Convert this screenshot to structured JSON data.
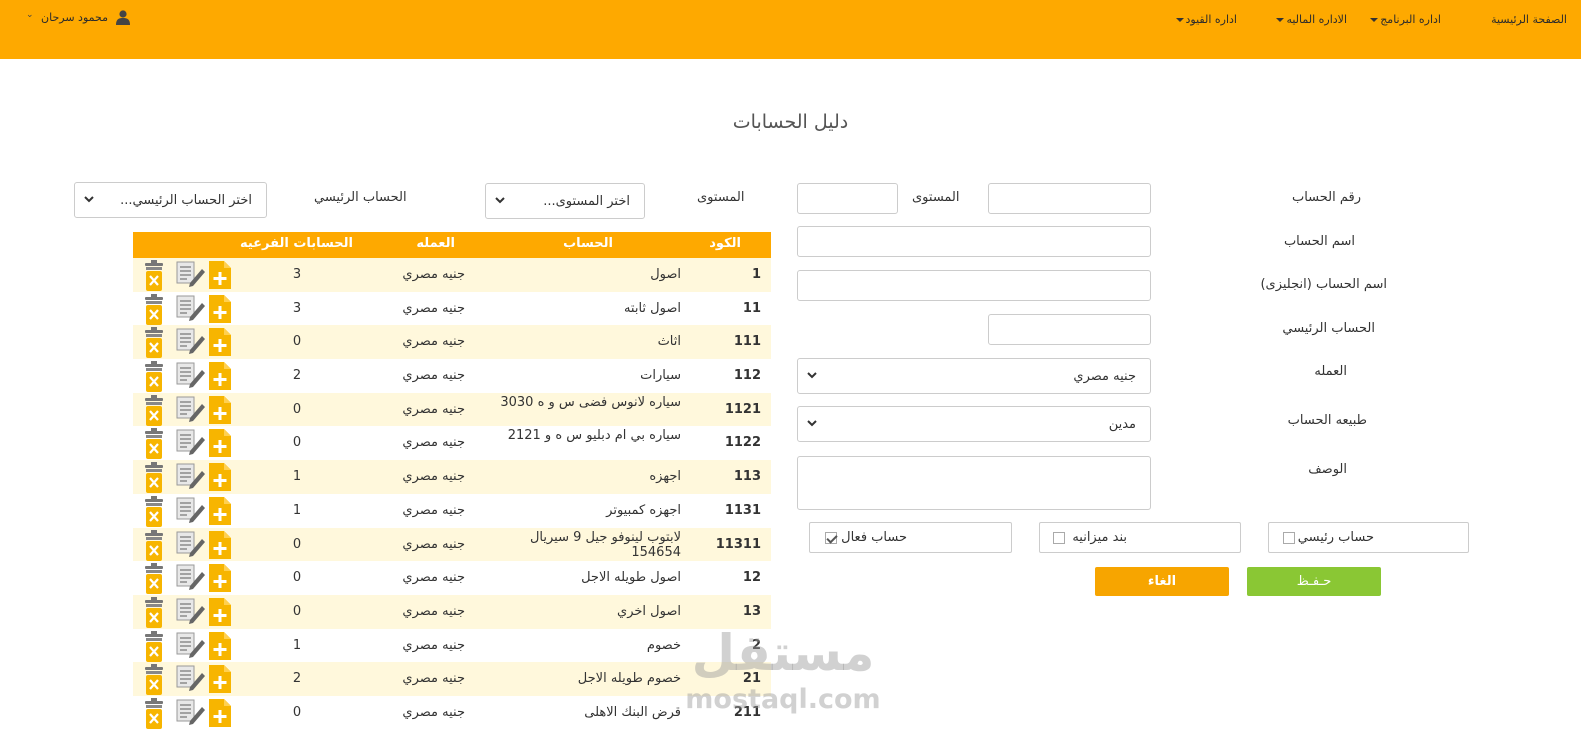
{
  "nav": {
    "items": [
      {
        "label": "الصفحة الرئيسية",
        "dropdown": false
      },
      {
        "label": "اداره البرنامج",
        "dropdown": true
      },
      {
        "label": "الاداره الماليه",
        "dropdown": true
      },
      {
        "label": "اداره القيود",
        "dropdown": true
      }
    ],
    "user": {
      "name": "محمود سرحان",
      "icon": "user-icon"
    }
  },
  "page_title": "دليل الحسابات",
  "form": {
    "account_number_label": "رقم الحساب",
    "level_label": "المستوى",
    "account_name_label": "اسم الحساب",
    "account_name_en_label": "اسم الحساب (انجليزى)",
    "parent_account_label": "الحساب الرئيسي",
    "currency_label": "العمله",
    "currency_value": "جنيه مصري",
    "nature_label": "طبيعه الحساب",
    "nature_value": "مدين",
    "description_label": "الوصف",
    "is_main_label": "حساب رئيسي",
    "is_main_checked": false,
    "budget_item_label": "بند ميزانيه",
    "budget_item_checked": false,
    "active_label": "حساب فعال",
    "active_checked": true,
    "cancel_label": "الغاء",
    "save_label": "حـفـظ"
  },
  "filters": {
    "level_label": "المستوى",
    "level_placeholder": "اختر المستوى...",
    "parent_label": "الحساب الرئيسي",
    "parent_placeholder": "اختر الحساب الرئيسي..."
  },
  "table": {
    "headers": {
      "code": "الكود",
      "account": "الحساب",
      "currency": "العمله",
      "sub_accounts": "الحسابات الفرعيه"
    },
    "rows": [
      {
        "code": "1",
        "name": "اصول",
        "currency": "جنيه مصري",
        "sub": "3"
      },
      {
        "code": "11",
        "name": "اصول ثابته",
        "currency": "جنيه مصري",
        "sub": "3"
      },
      {
        "code": "111",
        "name": "اثاث",
        "currency": "جنيه مصري",
        "sub": "0"
      },
      {
        "code": "112",
        "name": "سيارات",
        "currency": "جنيه مصري",
        "sub": "2"
      },
      {
        "code": "1121",
        "name": "سياره لانوس فضى س و ه 3030",
        "currency": "جنيه مصري",
        "sub": "0"
      },
      {
        "code": "1122",
        "name": "سياره بي ام دبليو س ه و 2121",
        "currency": "جنيه مصري",
        "sub": "0"
      },
      {
        "code": "113",
        "name": "اجهزه",
        "currency": "جنيه مصري",
        "sub": "1"
      },
      {
        "code": "1131",
        "name": "اجهزه كمبيوتر",
        "currency": "جنيه مصري",
        "sub": "1"
      },
      {
        "code": "11311",
        "name": "لابتوب لينوفو جيل 9 سيريال 154654",
        "currency": "جنيه مصري",
        "sub": "0"
      },
      {
        "code": "12",
        "name": "اصول طويله الاجل",
        "currency": "جنيه مصري",
        "sub": "0"
      },
      {
        "code": "13",
        "name": "اصول اخري",
        "currency": "جنيه مصري",
        "sub": "0"
      },
      {
        "code": "2",
        "name": "خصوم",
        "currency": "جنيه مصري",
        "sub": "1"
      },
      {
        "code": "21",
        "name": "خصوم طويله الاجل",
        "currency": "جنيه مصري",
        "sub": "2"
      },
      {
        "code": "211",
        "name": "قرض البنك الاهلى",
        "currency": "جنيه مصري",
        "sub": "0"
      }
    ]
  },
  "watermark": {
    "arabic": "مستقل",
    "latin": "mostaql.com"
  },
  "colors": {
    "accent": "#fea900",
    "save": "#8ac734",
    "cancel": "#f7a500",
    "row_alt": "#fff8dc"
  }
}
